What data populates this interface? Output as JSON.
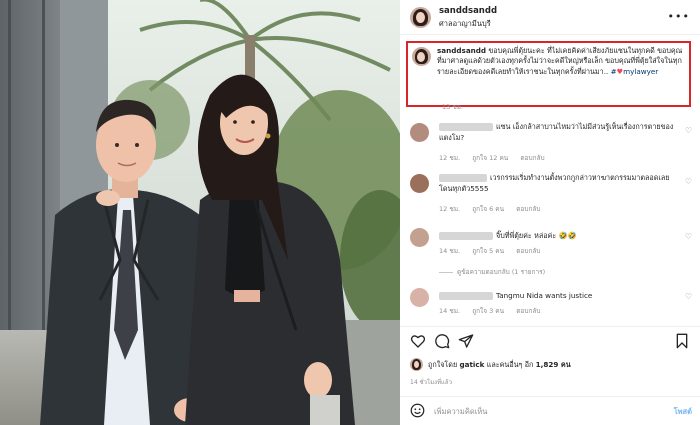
{
  "post": {
    "username": "sanddsandd",
    "location": "ศาลอาญามีนบุรี",
    "more_icon": "more-horizontal-icon",
    "photo_description_icon": "post-photo"
  },
  "caption": {
    "username": "sanddsandd",
    "text": "ขอบคุณพี่ตุ้ยนะคะ ที่ไม่เคยคิดค่าเสียงภัยแซนในทุกคดี ขอบคุณที่มาศาลดูแลด้วยตัวเองทุกครั้งไม่ว่าจะคดีใหญ่หรือเล็ก ขอบคุณที่พี่ตุ้ยใส่ใจในทุกรายละเอียดของคดีเลยทำให้เราชนะในทุกครั้งที่ผ่านมา..",
    "tag_prefix": "#",
    "tag": "mylawyer",
    "time": "13 ชม."
  },
  "comments": [
    {
      "text": "แซน เอ็งกล้าสาบานไหมว่าไม่มีส่วนรู้เห็นเรื่องการตายของแตงโม?",
      "time": "12 ชม.",
      "likes": "ถูกใจ 12 คน",
      "reply": "ตอบกลับ",
      "avatar_color": "#b28c7e"
    },
    {
      "text": "เวรกรรมเริ่มทำงานตั้งพวกกูกล่าวหาฆาตกรรมมาตลอดเลยโดนทุกตัว5555",
      "time": "12 ชม.",
      "likes": "ถูกใจ 6 คน",
      "reply": "ตอบกลับ",
      "avatar_color": "#9a6f5c"
    },
    {
      "text": "จิ๊บที่พี่ตุ้ยค่ะ หล่อค่ะ 🤣🤣",
      "time": "14 ชม.",
      "likes": "ถูกใจ 5 คน",
      "reply": "ตอบกลับ",
      "avatar_color": "#c3a08f",
      "view_replies": "ดูข้อความตอบกลับ (1 รายการ)"
    },
    {
      "text": "Tangmu Nida wants justice",
      "time": "14 ชม.",
      "likes": "ถูกใจ 3 คน",
      "reply": "ตอบกลับ",
      "avatar_color": "#d8b2a6"
    }
  ],
  "actions": {
    "like_icon": "heart-outline-icon",
    "comment_icon": "comment-bubble-icon",
    "share_icon": "paper-plane-icon",
    "save_icon": "bookmark-icon"
  },
  "likes": {
    "prefix": "ถูกใจโดย",
    "user": "gatick",
    "middle": "และคนอื่นๆ อีก",
    "count": "1,829 คน"
  },
  "post_time": "14 ชั่วโมงที่แล้ว",
  "add_comment": {
    "placeholder": "เพิ่มความคิดเห็น",
    "post_label": "โพสต์"
  },
  "colors": {
    "highlight_border": "#d9252a",
    "link": "#00376b",
    "muted": "#8e8e8e",
    "post_button": "#7ab8f0",
    "heart": "#ed4956"
  }
}
